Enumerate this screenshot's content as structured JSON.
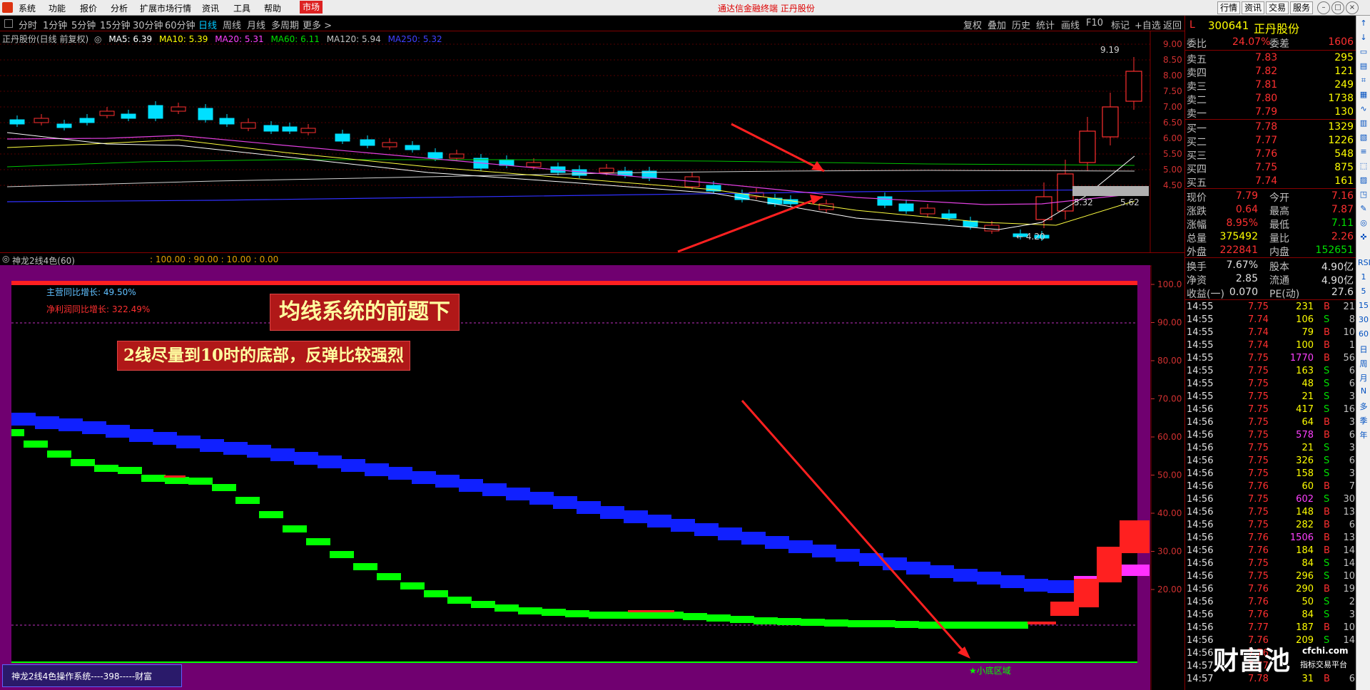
{
  "menu": {
    "items": [
      "系统",
      "功能",
      "报价",
      "分析",
      "扩展市场行情",
      "资讯",
      "工具",
      "帮助"
    ],
    "market_button": "市场",
    "title": "通达信金融终端  正丹股份",
    "right_buttons": [
      "行情",
      "资讯",
      "交易",
      "服务"
    ]
  },
  "periods": {
    "items": [
      "分时",
      "1分钟",
      "5分钟",
      "15分钟",
      "30分钟",
      "60分钟",
      "日线",
      "周线",
      "月线",
      "多周期",
      "更多 >"
    ],
    "active": "日线"
  },
  "toolbar": [
    "复权",
    "叠加",
    "历史",
    "统计",
    "画线",
    "F10",
    "标记",
    "+自选",
    "返回"
  ],
  "chart_header": {
    "stock_label": "正丹股份(日线 前复权)",
    "ma": [
      {
        "label": "MA5: 6.39",
        "color": "#ffffff"
      },
      {
        "label": "MA10: 5.39",
        "color": "#ffff00"
      },
      {
        "label": "MA20: 5.31",
        "color": "#ff40ff"
      },
      {
        "label": "MA60: 6.11",
        "color": "#00e000"
      },
      {
        "label": "MA120: 5.94",
        "color": "#c0c0c0"
      },
      {
        "label": "MA250: 5.32",
        "color": "#4040ff"
      }
    ]
  },
  "price_axis": [
    "9.00",
    "8.50",
    "8.00",
    "7.50",
    "7.00",
    "6.50",
    "6.00",
    "5.50",
    "5.00",
    "4.50"
  ],
  "price_annotations": {
    "high": "9.19",
    "low": "4.20",
    "mid1": "5.32",
    "mid2": "5.62"
  },
  "indicator": {
    "name": "神龙2线4色(60)",
    "params": ": 100.00 : 90.00 : 10.00 : 0.00",
    "axis": [
      "100.0",
      "90.00",
      "80.00",
      "70.00",
      "60.00",
      "50.00",
      "40.00",
      "30.00",
      "20.00"
    ],
    "stat1_label": "主营同比增长:",
    "stat1_value": "49.50%",
    "stat2_label": "净利润同比增长:",
    "stat2_value": "322.49%",
    "bottom_marker": "★小底区域",
    "system_label": "神龙2线4色操作系统----398-----财富"
  },
  "annotations": {
    "banner1": "均线系统的前题下",
    "banner2": "2线尽量到10时的底部，反弹比较强烈"
  },
  "quote": {
    "code": "300641",
    "name": "正丹股份",
    "prefix": "L",
    "weibi_label": "委比",
    "weibi": "24.07%",
    "weicha_label": "委差",
    "weicha": "1606",
    "asks": [
      {
        "label": "卖五",
        "price": "7.83",
        "vol": "295"
      },
      {
        "label": "卖四",
        "price": "7.82",
        "vol": "121"
      },
      {
        "label": "卖三",
        "price": "7.81",
        "vol": "249"
      },
      {
        "label": "卖二",
        "price": "7.80",
        "vol": "1738"
      },
      {
        "label": "卖一",
        "price": "7.79",
        "vol": "130"
      }
    ],
    "bids": [
      {
        "label": "买一",
        "price": "7.78",
        "vol": "1329"
      },
      {
        "label": "买二",
        "price": "7.77",
        "vol": "1226"
      },
      {
        "label": "买三",
        "price": "7.76",
        "vol": "548"
      },
      {
        "label": "买四",
        "price": "7.75",
        "vol": "875"
      },
      {
        "label": "买五",
        "price": "7.74",
        "vol": "161"
      }
    ],
    "stats": [
      {
        "l1": "现价",
        "v1": "7.79",
        "c1": "red",
        "l2": "今开",
        "v2": "7.16",
        "c2": "red"
      },
      {
        "l1": "涨跌",
        "v1": "0.64",
        "c1": "red",
        "l2": "最高",
        "v2": "7.87",
        "c2": "red"
      },
      {
        "l1": "涨幅",
        "v1": "8.95%",
        "c1": "red",
        "l2": "最低",
        "v2": "7.11",
        "c2": "green"
      },
      {
        "l1": "总量",
        "v1": "375492",
        "c1": "yellow",
        "l2": "量比",
        "v2": "2.26",
        "c2": "red"
      },
      {
        "l1": "外盘",
        "v1": "222841",
        "c1": "red",
        "l2": "内盘",
        "v2": "152651",
        "c2": "green"
      }
    ],
    "fundamentals": [
      {
        "l1": "换手",
        "v1": "7.67%",
        "l2": "股本",
        "v2": "4.90亿"
      },
      {
        "l1": "净资",
        "v1": "2.85",
        "l2": "流通",
        "v2": "4.90亿"
      },
      {
        "l1": "收益(一)",
        "v1": "0.070",
        "l2": "PE(动)",
        "v2": "27.6"
      }
    ],
    "ticks": [
      [
        "14:55",
        "7.75",
        "231",
        "B",
        "21"
      ],
      [
        "14:55",
        "7.74",
        "106",
        "S",
        "8"
      ],
      [
        "14:55",
        "7.74",
        "79",
        "B",
        "10"
      ],
      [
        "14:55",
        "7.74",
        "100",
        "B",
        "1"
      ],
      [
        "14:55",
        "7.75",
        "1770",
        "B",
        "56"
      ],
      [
        "14:55",
        "7.75",
        "163",
        "S",
        "6"
      ],
      [
        "14:55",
        "7.75",
        "48",
        "S",
        "6"
      ],
      [
        "14:55",
        "7.75",
        "21",
        "S",
        "3"
      ],
      [
        "14:56",
        "7.75",
        "417",
        "S",
        "16"
      ],
      [
        "14:56",
        "7.75",
        "64",
        "B",
        "3"
      ],
      [
        "14:56",
        "7.75",
        "578",
        "B",
        "6"
      ],
      [
        "14:56",
        "7.75",
        "21",
        "S",
        "3"
      ],
      [
        "14:56",
        "7.75",
        "326",
        "S",
        "6"
      ],
      [
        "14:56",
        "7.75",
        "158",
        "S",
        "3"
      ],
      [
        "14:56",
        "7.76",
        "60",
        "B",
        "7"
      ],
      [
        "14:56",
        "7.75",
        "602",
        "S",
        "30"
      ],
      [
        "14:56",
        "7.75",
        "148",
        "B",
        "13"
      ],
      [
        "14:56",
        "7.75",
        "282",
        "B",
        "6"
      ],
      [
        "14:56",
        "7.76",
        "1506",
        "B",
        "13"
      ],
      [
        "14:56",
        "7.76",
        "184",
        "B",
        "14"
      ],
      [
        "14:56",
        "7.75",
        "84",
        "S",
        "14"
      ],
      [
        "14:56",
        "7.75",
        "296",
        "S",
        "10"
      ],
      [
        "14:56",
        "7.76",
        "290",
        "B",
        "19"
      ],
      [
        "14:56",
        "7.76",
        "50",
        "S",
        "2"
      ],
      [
        "14:56",
        "7.76",
        "84",
        "S",
        "3"
      ],
      [
        "14:56",
        "7.77",
        "187",
        "B",
        "10"
      ],
      [
        "14:56",
        "7.76",
        "209",
        "S",
        "14"
      ],
      [
        "14:56",
        "7.76",
        "",
        "",
        ""
      ],
      [
        "14:57",
        "7.77",
        "",
        "",
        ""
      ],
      [
        "14:57",
        "7.78",
        "31",
        "B",
        "6"
      ]
    ]
  },
  "sidebar_labels": [
    "RSI",
    "1",
    "5",
    "15",
    "30",
    "60",
    "日",
    "周",
    "月",
    "N",
    "多",
    "季",
    "年"
  ],
  "watermark": {
    "brand": "财富池",
    "site": "cfchi.com",
    "tagline": "指标交易平台"
  }
}
